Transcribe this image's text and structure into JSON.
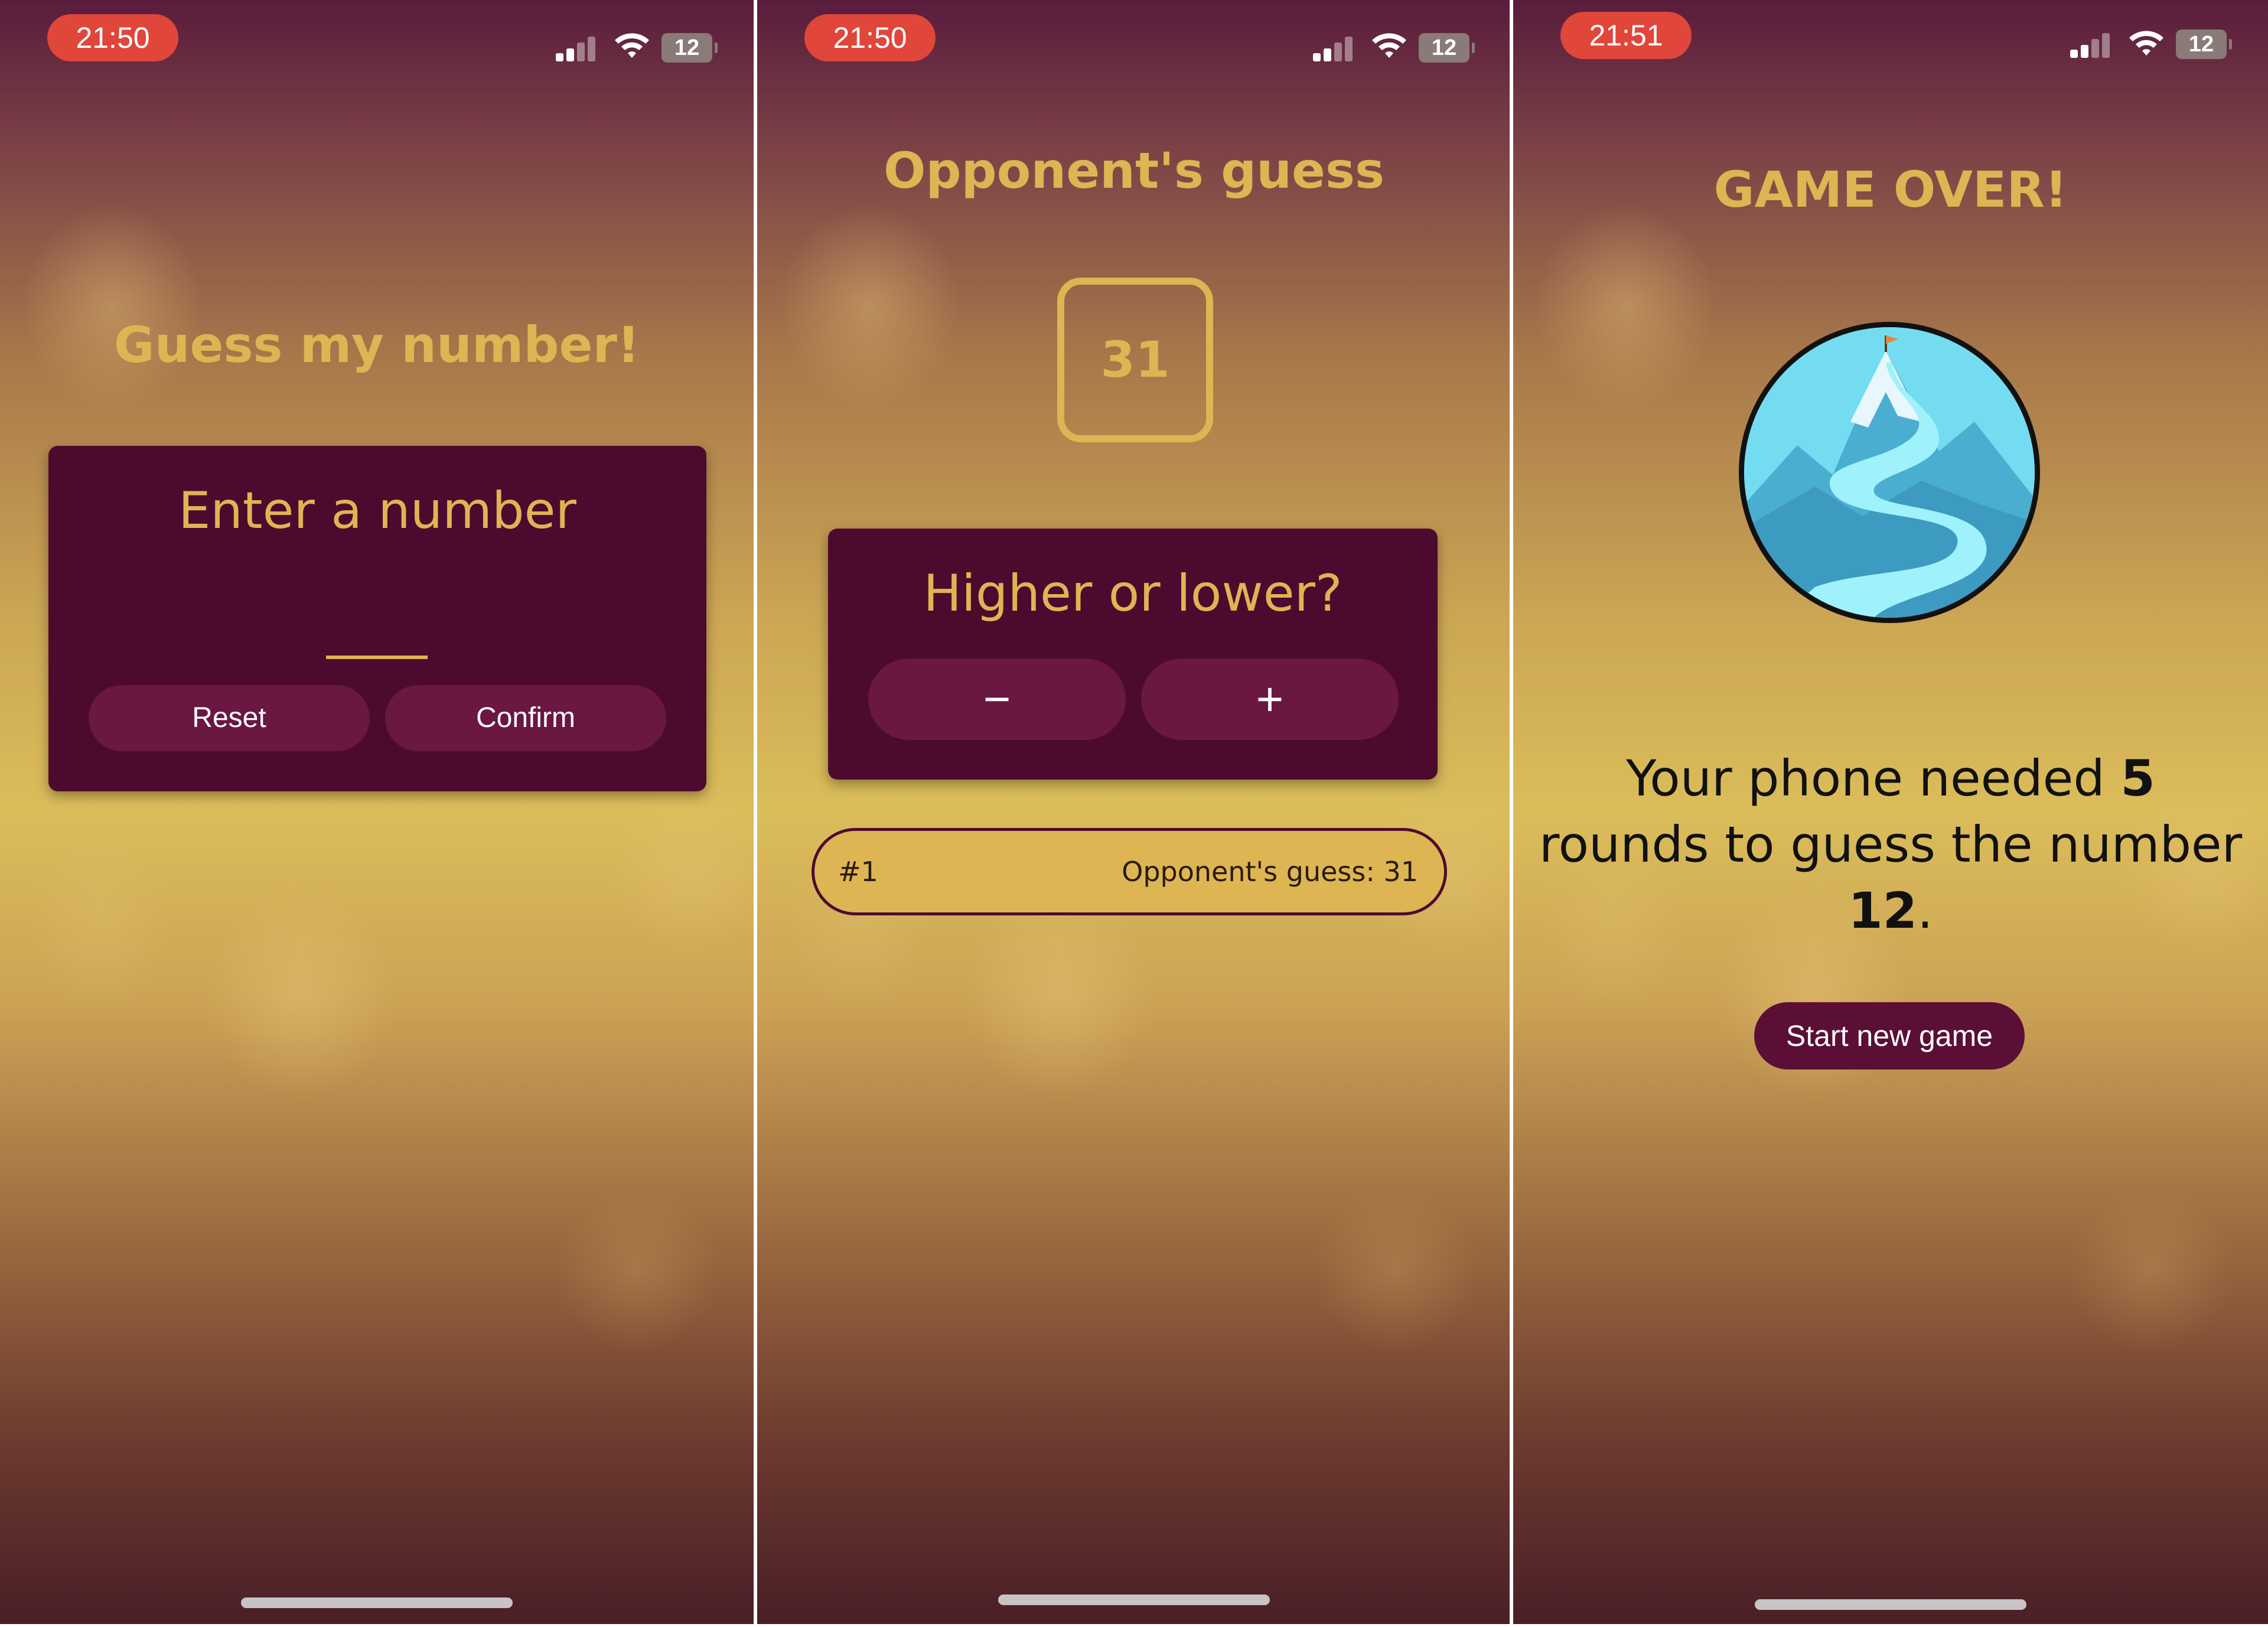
{
  "colors": {
    "gold": "#ddb552",
    "card_bg": "#4d0a2f",
    "button_bg": "#6a1742",
    "status_time_pill": "#e0463a"
  },
  "screens": [
    {
      "status": {
        "time": "21:50",
        "battery": "12"
      },
      "title": "Guess my number!",
      "card": {
        "prompt": "Enter a number",
        "input_value": "",
        "reset_label": "Reset",
        "confirm_label": "Confirm"
      }
    },
    {
      "status": {
        "time": "21:50",
        "battery": "12"
      },
      "title": "Opponent's guess",
      "current_guess": "31",
      "card": {
        "prompt": "Higher or lower?",
        "lower_label": "−",
        "higher_label": "+"
      },
      "log": [
        {
          "round": "#1",
          "text": "Opponent's guess: 31"
        }
      ]
    },
    {
      "status": {
        "time": "21:51",
        "battery": "12"
      },
      "title": "GAME OVER!",
      "summary": {
        "before_rounds": "Your phone needed ",
        "rounds": "5",
        "middle": " rounds to guess the number ",
        "number": "12",
        "after": "."
      },
      "new_game_label": "Start new game"
    }
  ]
}
